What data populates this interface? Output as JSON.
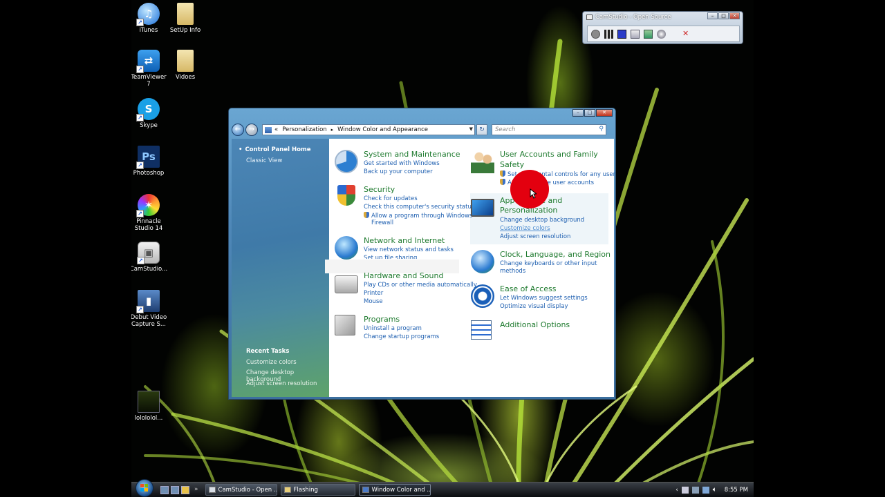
{
  "desktop": {
    "icons": [
      {
        "label": "iTunes",
        "icon": "itunes-icon"
      },
      {
        "label": "SetUp Info",
        "icon": "folder-icon"
      },
      {
        "label": "TeamViewer 7",
        "icon": "teamviewer-icon"
      },
      {
        "label": "Vidoes",
        "icon": "folder-icon"
      },
      {
        "label": "Skype",
        "icon": "skype-icon"
      },
      {
        "label": "Photoshop",
        "icon": "photoshop-icon"
      },
      {
        "label": "Pinnacle Studio 14",
        "icon": "pinnacle-icon"
      },
      {
        "label": "CamStudio...",
        "icon": "camstudio-icon"
      },
      {
        "label": "Debut Video Capture S...",
        "icon": "film-icon"
      },
      {
        "label": "lolololol...",
        "icon": "image-file-icon"
      }
    ]
  },
  "camstudio": {
    "title": "CamStudio - Open Source"
  },
  "window": {
    "address": {
      "sep": "«",
      "crumbs": [
        "Personalization",
        "Window Color and Appearance"
      ]
    },
    "search_placeholder": "Search",
    "left_pane": {
      "home": "Control Panel Home",
      "classic": "Classic View",
      "recent_title": "Recent Tasks",
      "recent": [
        "Customize colors",
        "Change desktop background",
        "Adjust screen resolution"
      ]
    },
    "categories": [
      {
        "title": "System and Maintenance",
        "links": [
          "Get started with Windows",
          "Back up your computer"
        ]
      },
      {
        "title": "Security",
        "links": [
          "Check for updates",
          "Check this computer's security status",
          "Allow a program through Windows",
          "Firewall"
        ]
      },
      {
        "title": "Network and Internet",
        "links": [
          "View network status and tasks",
          "Set up file sharing"
        ]
      },
      {
        "title": "Hardware and Sound",
        "links": [
          "Play CDs or other media automatically",
          "Printer",
          "Mouse"
        ]
      },
      {
        "title": "Programs",
        "links": [
          "Uninstall a program",
          "Change startup programs"
        ]
      },
      {
        "title": "User Accounts and Family",
        "title2": "Safety",
        "links": [
          "Set up parental controls for any user",
          "Add or remove user accounts"
        ]
      },
      {
        "title": "Appearance and",
        "title2": "Personalization",
        "links": [
          "Change desktop background",
          "Customize colors",
          "Adjust screen resolution"
        ]
      },
      {
        "title": "Clock, Language, and Region",
        "links": [
          "Change keyboards or other input",
          "methods"
        ]
      },
      {
        "title": "Ease of Access",
        "links": [
          "Let Windows suggest settings",
          "Optimize visual display"
        ]
      },
      {
        "title": "Additional Options",
        "links": []
      }
    ]
  },
  "taskbar": {
    "tasks": [
      "CamStudio - Open ...",
      "Flashing",
      "Window Color and ..."
    ],
    "quicklaunch_more": "»",
    "tray_arrow": "‹",
    "clock": "8:55 PM"
  },
  "colors": {
    "link": "#1e5fb0",
    "category_title": "#1e7a2e",
    "highlight_circle": "#e3000f"
  }
}
